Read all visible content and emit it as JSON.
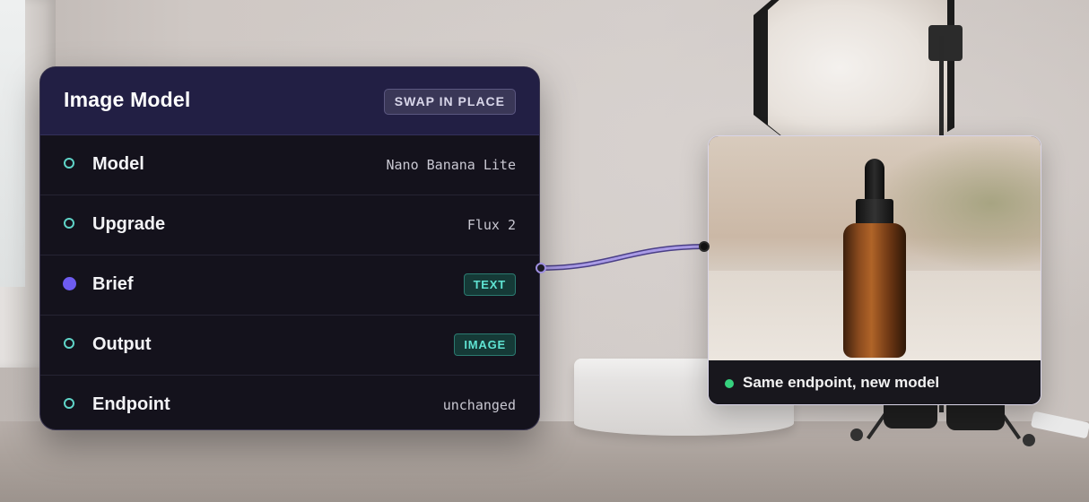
{
  "node": {
    "title": "Image Model",
    "swap_label": "SWAP IN PLACE",
    "rows": [
      {
        "label": "Model",
        "value": "Nano Banana Lite",
        "kind": "value"
      },
      {
        "label": "Upgrade",
        "value": "Flux 2",
        "kind": "value"
      },
      {
        "label": "Brief",
        "value": "TEXT",
        "kind": "badge"
      },
      {
        "label": "Output",
        "value": "IMAGE",
        "kind": "badge"
      },
      {
        "label": "Endpoint",
        "value": "unchanged",
        "kind": "value"
      }
    ]
  },
  "output": {
    "caption": "Same endpoint, new model"
  },
  "colors": {
    "node_bg": "#14121c",
    "header_bg": "#221f44",
    "port_teal": "#5fd3c7",
    "port_purple": "#6e5cf0",
    "badge_text": "#5fe3d2",
    "status_green": "#36d17e",
    "connector": "#a99be6"
  },
  "icons": {
    "row_port": "hollow-circle",
    "brief_port": "filled-circle",
    "status": "green-dot"
  }
}
